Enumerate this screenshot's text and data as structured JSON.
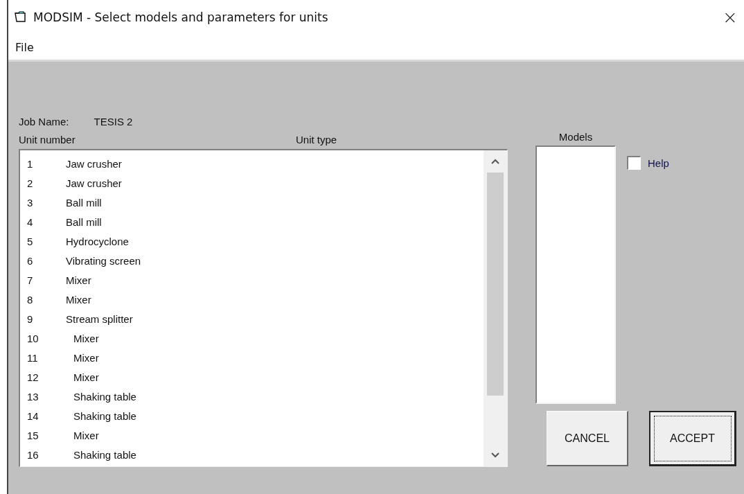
{
  "window": {
    "title": "MODSIM - Select models and parameters for units",
    "close": "×"
  },
  "menu": [
    "File"
  ],
  "job": {
    "label": "Job Name:",
    "value": "TESIS 2"
  },
  "columns": [
    "Unit number",
    "Unit type"
  ],
  "units": [
    {
      "number": "1",
      "type": "Jaw crusher"
    },
    {
      "number": "2",
      "type": "Jaw crusher"
    },
    {
      "number": "3",
      "type": "Ball mill"
    },
    {
      "number": "4",
      "type": "Ball mill"
    },
    {
      "number": "5",
      "type": "Hydrocyclone"
    },
    {
      "number": "6",
      "type": "Vibrating screen"
    },
    {
      "number": "7",
      "type": "Mixer"
    },
    {
      "number": "8",
      "type": "Mixer"
    },
    {
      "number": "9",
      "type": "Stream splitter"
    },
    {
      "number": "10",
      "type": "Mixer"
    },
    {
      "number": "11",
      "type": "Mixer"
    },
    {
      "number": "12",
      "type": "Mixer"
    },
    {
      "number": "13",
      "type": "Shaking table"
    },
    {
      "number": "14",
      "type": "Shaking table"
    },
    {
      "number": "15",
      "type": "Mixer"
    },
    {
      "number": "16",
      "type": "Shaking table"
    }
  ],
  "models": {
    "label": "Models"
  },
  "help": {
    "label": "Help",
    "checked": false
  },
  "buttons": [
    {
      "label": "CANCEL",
      "default": false
    },
    {
      "label": "ACCEPT",
      "default": true
    }
  ]
}
